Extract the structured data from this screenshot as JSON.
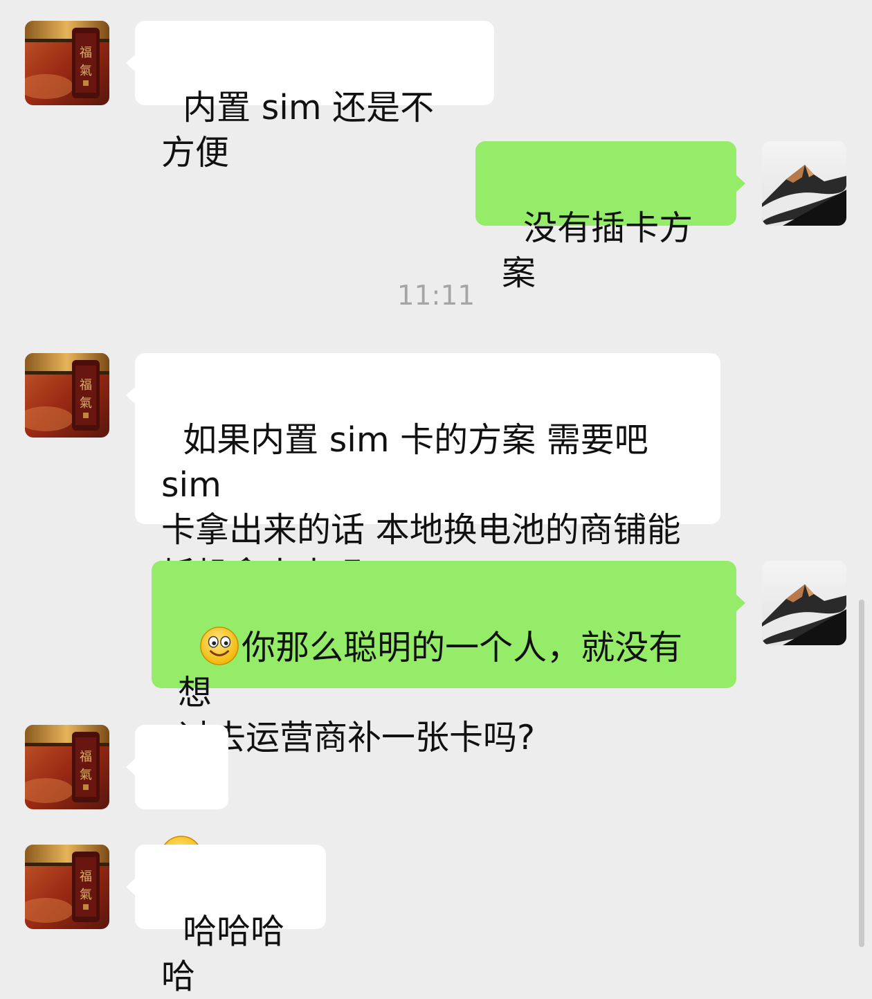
{
  "messages": [
    {
      "side": "received",
      "text": "内置 sim 还是不方便"
    },
    {
      "side": "sent",
      "text": "没有插卡方案"
    },
    {
      "side": "received",
      "text": "如果内置 sim 卡的方案 需要吧 sim\n卡拿出来的话 本地换电池的商铺能\n拆机拿出来吗"
    },
    {
      "side": "sent",
      "emoji": "smile-emoji",
      "text": "你那么聪明的一个人，就没有想\n过去运营商补一张卡吗?"
    },
    {
      "side": "received",
      "emoji": "facepalm-peek-emoji"
    },
    {
      "side": "received",
      "text": "哈哈哈哈"
    }
  ],
  "timestamp": "11:11",
  "avatars": {
    "received": "red-cabinet-photo-avatar",
    "sent": "snow-mountain-peak-avatar"
  },
  "colors": {
    "background": "#ededed",
    "received_bubble": "#ffffff",
    "sent_bubble": "#95ec69",
    "timestamp": "#a5a5a5"
  }
}
